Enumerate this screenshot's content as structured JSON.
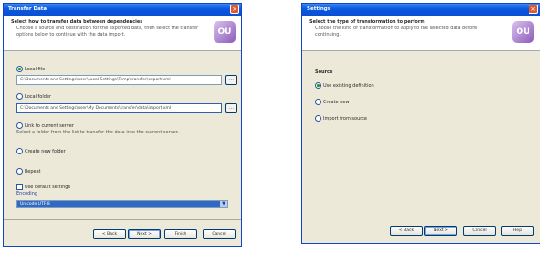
{
  "left_window": {
    "title": "Transfer Data",
    "banner_title": "Select how to transfer data between dependencies",
    "banner_desc": "Choose a source and destination for the exported data, then select the transfer options below to continue with the data import.",
    "logo_text": "OU",
    "options": [
      {
        "label": "Local file",
        "selected": true
      },
      {
        "label": "Local folder",
        "selected": false
      },
      {
        "label": "Link to current server",
        "selected": false
      },
      {
        "label": "Create new folder",
        "selected": false
      },
      {
        "label": "Repeat",
        "selected": false
      }
    ],
    "field1_value": "C:\\Documents and Settings\\user\\Local Settings\\Temp\\transfer\\export.xml",
    "field2_value": "C:\\Documents and Settings\\user\\My Documents\\transfer\\data\\import.xml",
    "link_desc": "Select a folder from the list to transfer the data into the current server.",
    "checkbox_label": "Use default settings",
    "dropdown_label": "Encoding",
    "dropdown_value": "Unicode UTF-8",
    "buttons": {
      "back": "< Back",
      "next": "Next >",
      "finish": "Finish",
      "cancel": "Cancel"
    }
  },
  "right_window": {
    "title": "Settings",
    "banner_title": "Select the type of transformation to perform",
    "banner_desc": "Choose the kind of transformation to apply to the selected data before continuing.",
    "logo_text": "OU",
    "group_label": "Source",
    "options": [
      {
        "label": "Use existing definition",
        "selected": true
      },
      {
        "label": "Create new",
        "selected": false
      },
      {
        "label": "Import from source",
        "selected": false
      }
    ],
    "buttons": {
      "back": "< Back",
      "next": "Next >",
      "cancel": "Cancel",
      "help": "Help"
    }
  }
}
